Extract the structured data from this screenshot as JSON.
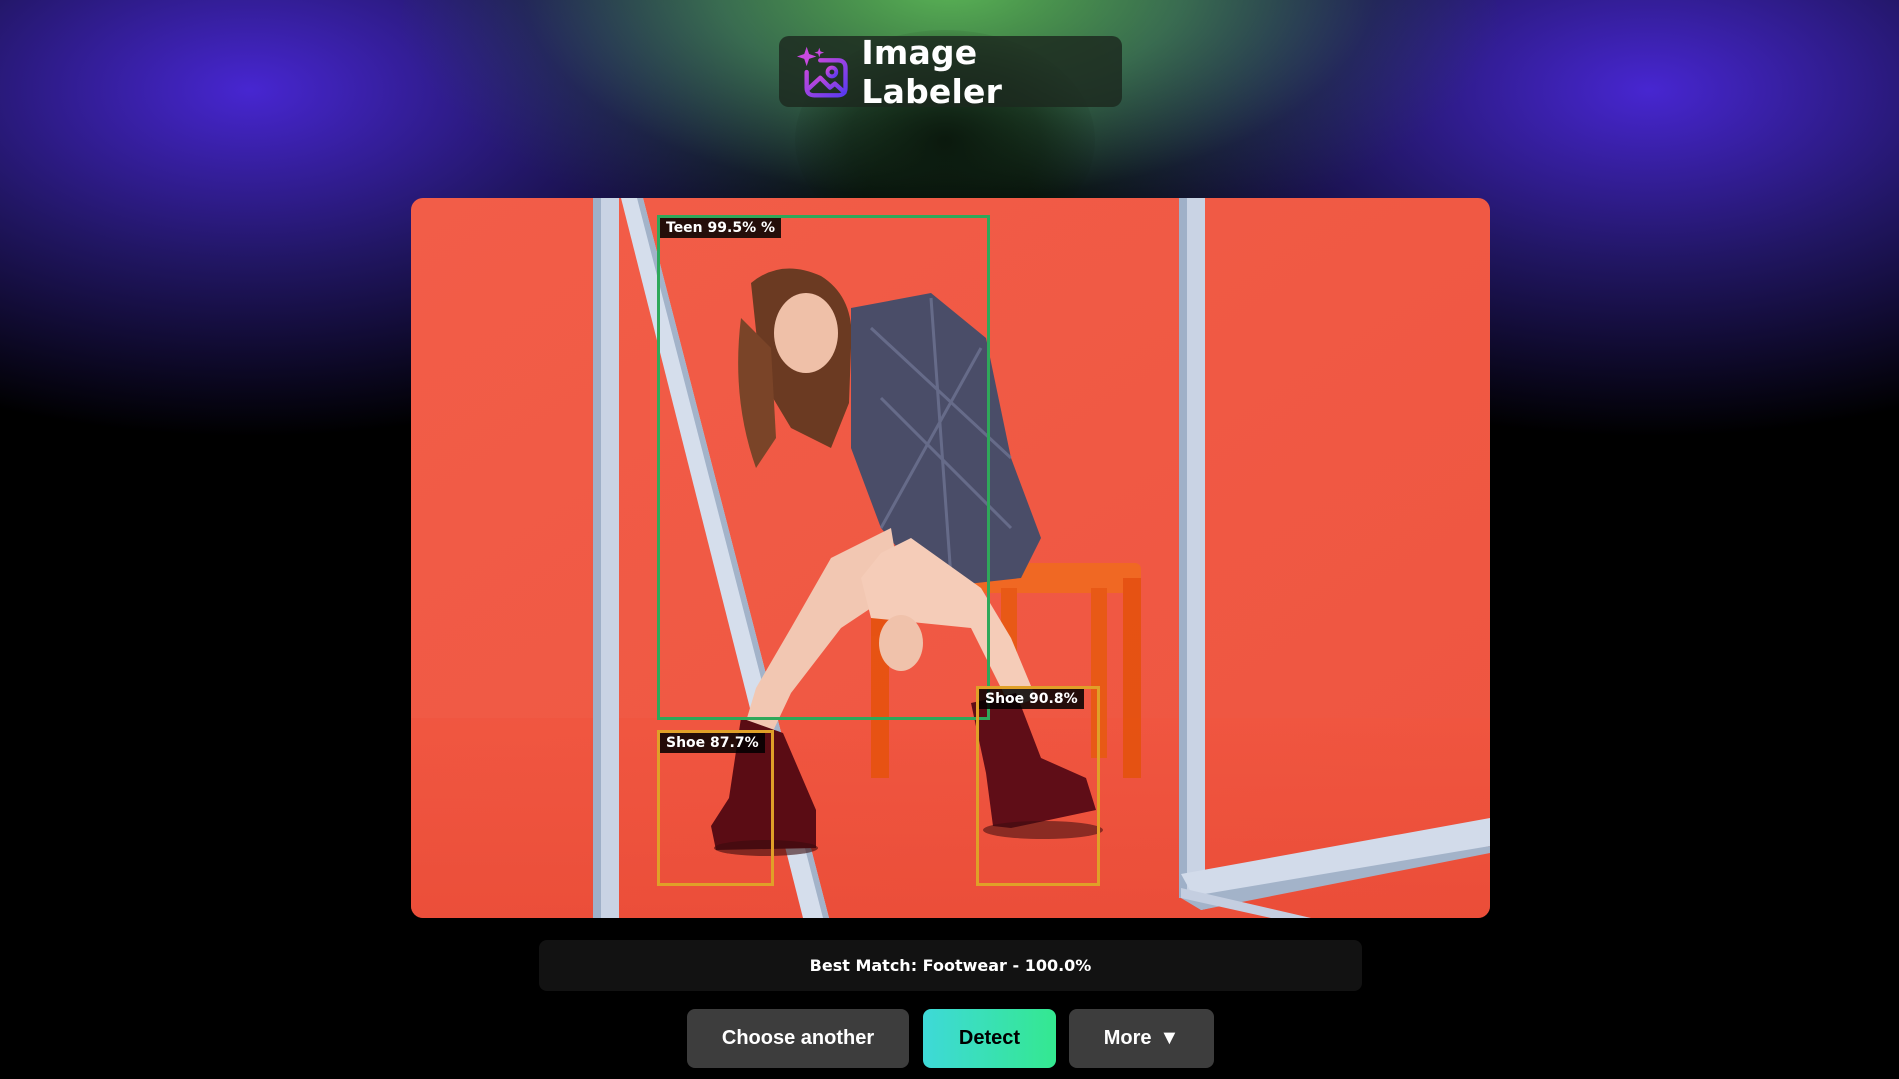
{
  "app": {
    "title": "Image Labeler",
    "logo_icon": "sparkle-image-icon"
  },
  "detections": [
    {
      "label": "Teen 99.5% %",
      "color": "#2fa85a"
    },
    {
      "label": "Shoe 90.8%",
      "color": "#e0a028"
    },
    {
      "label": "Shoe 87.7%",
      "color": "#e0a028"
    }
  ],
  "result": {
    "prefix": "Best Match:",
    "label": "Footwear",
    "separator": " - ",
    "confidence": "100.0%"
  },
  "buttons": {
    "choose_another": "Choose another",
    "detect": "Detect",
    "more": "More",
    "more_icon": "▼"
  },
  "colors": {
    "background": "#000000",
    "accent_purple": "#4b28dc",
    "accent_green": "#5fbe5a",
    "detect_gradient_start": "#3ed9d8",
    "detect_gradient_end": "#34e890",
    "photo_background": "#f25a45"
  }
}
